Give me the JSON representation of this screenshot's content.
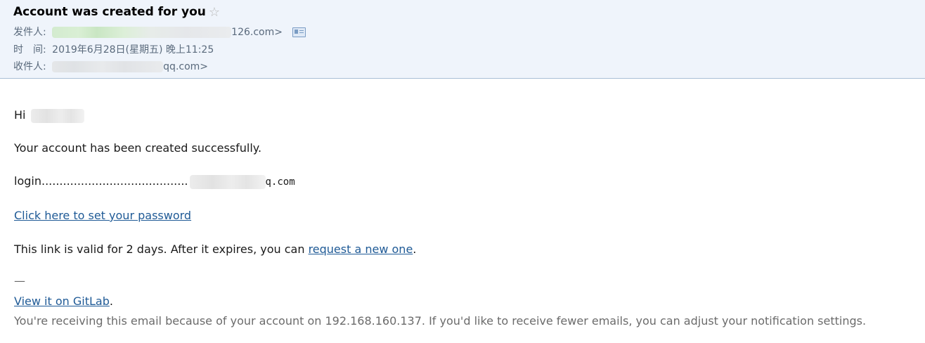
{
  "header": {
    "subject": "Account was created for you",
    "star": "☆",
    "from_label": "发件人:",
    "from_suffix": "126.com>",
    "time_label": "时　间:",
    "time_value": "2019年6月28日(星期五) 晚上11:25",
    "to_label": "收件人:",
    "to_suffix": "qq.com>"
  },
  "email": {
    "greeting": "Hi",
    "line1": "Your account has been created successfully.",
    "login_label": "login.........................................",
    "login_suffix": "q.com",
    "set_password_link": "Click here to set your password",
    "valid_text": "This link is valid for 2 days. After it expires, you can ",
    "request_link": "request a new one",
    "period": ".",
    "separator": "—",
    "gitlab_link": "View it on GitLab",
    "gitlab_period": ".",
    "footer": "You're receiving this email because of your account on 192.168.160.137. If you'd like to receive fewer emails, you can adjust your notification settings."
  },
  "colors": {
    "header_bg": "#eff4fb",
    "link": "#1f5a96",
    "meta_text": "#5a6a7c"
  }
}
